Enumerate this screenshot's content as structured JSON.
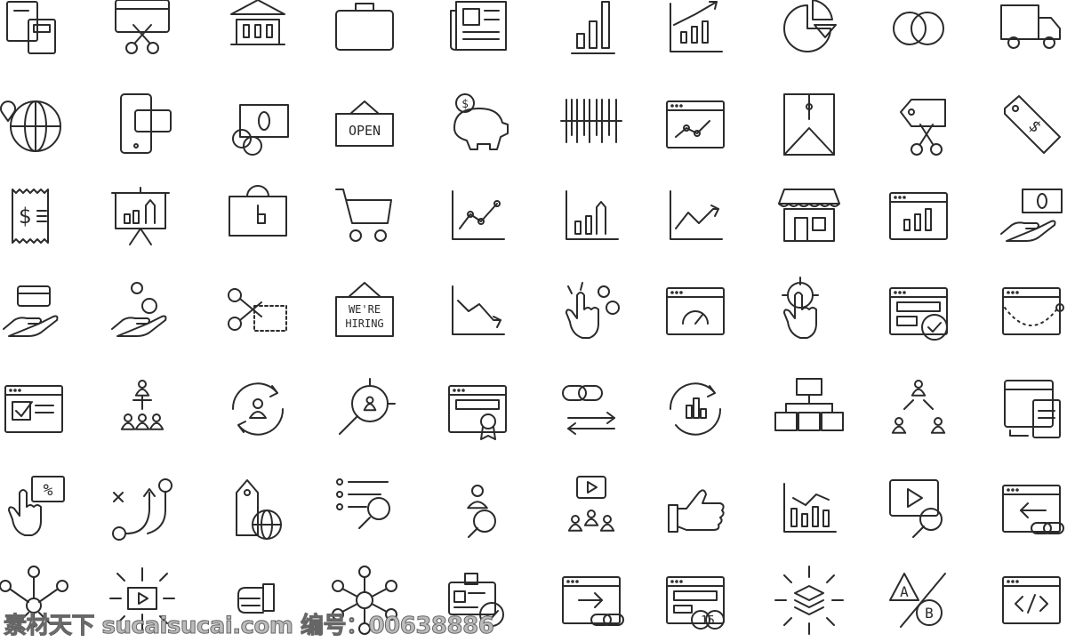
{
  "icons": [
    {
      "name": "clipboard-calculator-icon"
    },
    {
      "name": "credit-card-scissors-icon"
    },
    {
      "name": "bank-icon"
    },
    {
      "name": "briefcase-icon"
    },
    {
      "name": "newspaper-icon"
    },
    {
      "name": "bar-chart-icon"
    },
    {
      "name": "growth-chart-icon"
    },
    {
      "name": "pie-chart-icon"
    },
    {
      "name": "overlapping-circles-icon"
    },
    {
      "name": "delivery-truck-icon"
    },
    {
      "name": "global-location-icon"
    },
    {
      "name": "mobile-payment-icon"
    },
    {
      "name": "cash-coins-icon"
    },
    {
      "name": "open-sign-icon",
      "label": "OPEN"
    },
    {
      "name": "piggy-bank-icon",
      "label": "$"
    },
    {
      "name": "barcode-icon"
    },
    {
      "name": "browser-analytics-icon"
    },
    {
      "name": "envelope-icon"
    },
    {
      "name": "price-tag-scissors-icon"
    },
    {
      "name": "dollar-price-tag-icon",
      "label": "$"
    },
    {
      "name": "receipt-icon",
      "label": "$"
    },
    {
      "name": "presentation-board-icon"
    },
    {
      "name": "shopping-bag-icon"
    },
    {
      "name": "shopping-cart-icon"
    },
    {
      "name": "line-chart-icon"
    },
    {
      "name": "rising-bar-chart-icon"
    },
    {
      "name": "trend-up-icon"
    },
    {
      "name": "storefront-icon"
    },
    {
      "name": "browser-bar-chart-icon"
    },
    {
      "name": "hand-cash-icon"
    },
    {
      "name": "hand-card-icon"
    },
    {
      "name": "hand-coins-icon"
    },
    {
      "name": "scissors-coupon-icon"
    },
    {
      "name": "hiring-sign-icon",
      "label": "WE'RE",
      "label2": "HIRING"
    },
    {
      "name": "trend-down-icon"
    },
    {
      "name": "tap-coins-icon"
    },
    {
      "name": "browser-speedometer-icon"
    },
    {
      "name": "target-tap-icon"
    },
    {
      "name": "browser-approved-icon"
    },
    {
      "name": "browser-funnel-icon"
    },
    {
      "name": "browser-checklist-icon"
    },
    {
      "name": "team-hierarchy-icon"
    },
    {
      "name": "user-refresh-icon"
    },
    {
      "name": "search-target-user-icon"
    },
    {
      "name": "browser-certificate-icon"
    },
    {
      "name": "link-exchange-icon"
    },
    {
      "name": "chart-refresh-icon"
    },
    {
      "name": "sitemap-icon"
    },
    {
      "name": "user-network-icon"
    },
    {
      "name": "responsive-pages-icon"
    },
    {
      "name": "tap-discount-icon",
      "label": "%"
    },
    {
      "name": "strategy-path-icon"
    },
    {
      "name": "tag-globe-icon"
    },
    {
      "name": "list-search-icon"
    },
    {
      "name": "user-search-icon"
    },
    {
      "name": "video-audience-icon"
    },
    {
      "name": "thumbs-up-icon"
    },
    {
      "name": "chart-analysis-icon"
    },
    {
      "name": "video-search-icon"
    },
    {
      "name": "browser-backlink-icon"
    },
    {
      "name": "network-distribution-icon"
    },
    {
      "name": "video-distribution-icon"
    },
    {
      "name": "handshake-icon"
    },
    {
      "name": "molecule-network-icon"
    },
    {
      "name": "id-card-verified-icon"
    },
    {
      "name": "browser-redirect-link-icon"
    },
    {
      "name": "browser-number-icon",
      "label": "15"
    },
    {
      "name": "layers-expand-icon"
    },
    {
      "name": "ab-test-icon",
      "label": "A",
      "label2": "B"
    },
    {
      "name": "browser-code-icon"
    }
  ],
  "watermark": "素材天下 sucaisucai.com 编号：00638886"
}
